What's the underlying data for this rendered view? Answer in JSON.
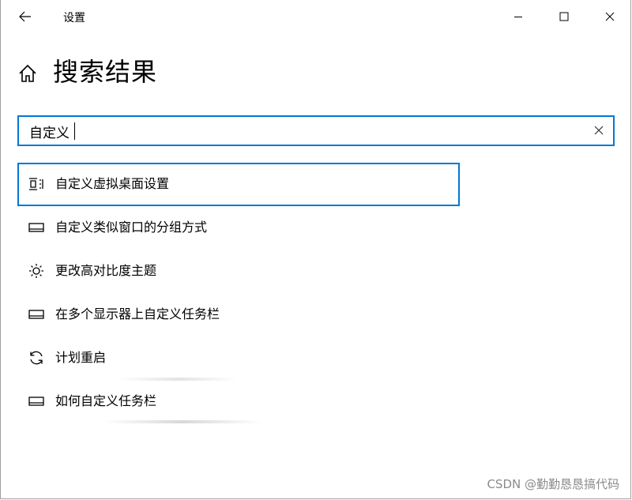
{
  "window": {
    "title": "设置"
  },
  "header": {
    "title": "搜索结果"
  },
  "search": {
    "value": "自定义",
    "placeholder": ""
  },
  "results": [
    {
      "label": "自定义虚拟桌面设置",
      "icon": "virtual-desktop-icon",
      "selected": true
    },
    {
      "label": "自定义类似窗口的分组方式",
      "icon": "taskbar-icon",
      "selected": false
    },
    {
      "label": "更改高对比度主题",
      "icon": "brightness-icon",
      "selected": false
    },
    {
      "label": "在多个显示器上自定义任务栏",
      "icon": "taskbar-icon",
      "selected": false
    },
    {
      "label": "计划重启",
      "icon": "refresh-icon",
      "selected": false
    },
    {
      "label": "如何自定义任务栏",
      "icon": "taskbar-icon",
      "selected": false
    }
  ],
  "watermark": "CSDN @勤勤恳恳搞代码",
  "colors": {
    "accent": "#0078d7"
  }
}
